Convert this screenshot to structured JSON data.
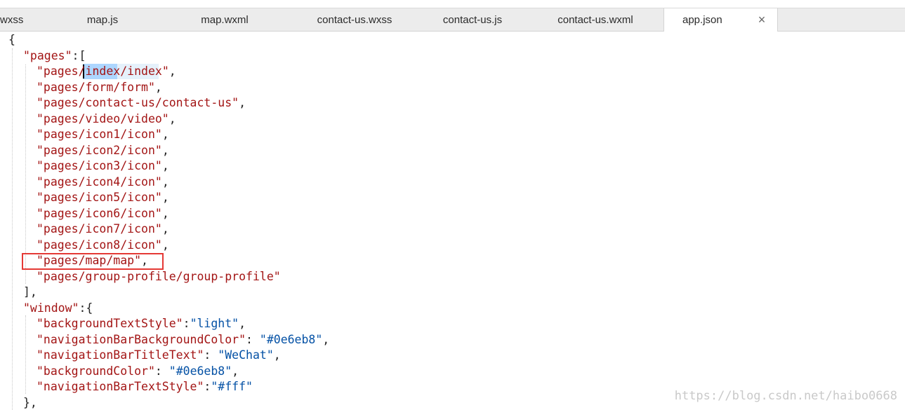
{
  "tabs": [
    {
      "label": "wxss",
      "active": false
    },
    {
      "label": "map.js",
      "active": false
    },
    {
      "label": "map.wxml",
      "active": false
    },
    {
      "label": "contact-us.wxss",
      "active": false
    },
    {
      "label": "contact-us.js",
      "active": false
    },
    {
      "label": "contact-us.wxml",
      "active": false
    },
    {
      "label": "app.json",
      "active": true
    }
  ],
  "close_icon": "×",
  "code": {
    "open_brace": "{",
    "pages_key": "\"pages\"",
    "pages_open": ":[",
    "pages": [
      {
        "pre": "\"pages/",
        "sel": "index",
        "post": "/index\"",
        "trail": ","
      },
      {
        "text": "\"pages/form/form\"",
        "trail": ","
      },
      {
        "text": "\"pages/contact-us/contact-us\"",
        "trail": ","
      },
      {
        "text": "\"pages/video/video\"",
        "trail": ","
      },
      {
        "text": "\"pages/icon1/icon\"",
        "trail": ","
      },
      {
        "text": "\"pages/icon2/icon\"",
        "trail": ","
      },
      {
        "text": "\"pages/icon3/icon\"",
        "trail": ","
      },
      {
        "text": "\"pages/icon4/icon\"",
        "trail": ","
      },
      {
        "text": "\"pages/icon5/icon\"",
        "trail": ","
      },
      {
        "text": "\"pages/icon6/icon\"",
        "trail": ","
      },
      {
        "text": "\"pages/icon7/icon\"",
        "trail": ","
      },
      {
        "text": "\"pages/icon8/icon\"",
        "trail": ","
      },
      {
        "text": "\"pages/map/map\"",
        "trail": ","
      },
      {
        "text": "\"pages/group-profile/group-profile\"",
        "trail": ""
      }
    ],
    "pages_close": "],",
    "window_key": "\"window\"",
    "window_open": ":{",
    "window_props": [
      {
        "key": "\"backgroundTextStyle\"",
        "sep": ":",
        "value": "\"light\"",
        "trail": ","
      },
      {
        "key": "\"navigationBarBackgroundColor\"",
        "sep": ": ",
        "value": "\"#0e6eb8\"",
        "trail": ","
      },
      {
        "key": "\"navigationBarTitleText\"",
        "sep": ": ",
        "value": "\"WeChat\"",
        "trail": ","
      },
      {
        "key": "\"backgroundColor\"",
        "sep": ": ",
        "value": "\"#0e6eb8\"",
        "trail": ","
      },
      {
        "key": "\"navigationBarTextStyle\"",
        "sep": ":",
        "value": "\"#fff\"",
        "trail": ""
      }
    ],
    "window_close": "},"
  },
  "watermark": "https://blog.csdn.net/haibo0668",
  "colors": {
    "key": "#a31515",
    "value": "#0451a5",
    "annotation_box": "#e53935",
    "selection": "#add6ff"
  }
}
